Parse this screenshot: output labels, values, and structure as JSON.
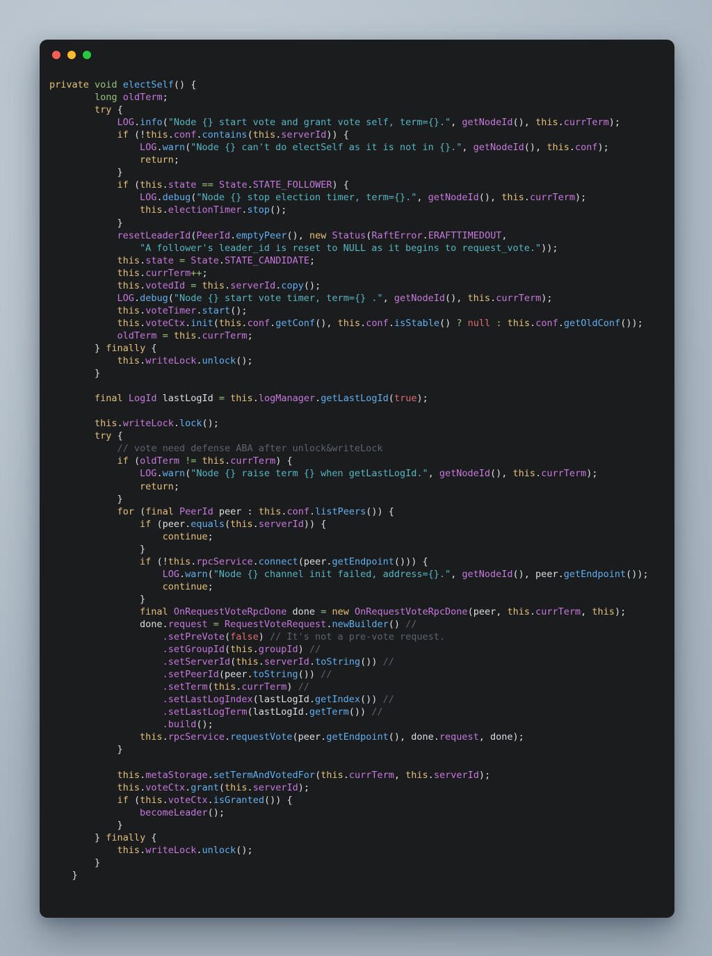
{
  "window": {
    "title": "",
    "traffic_lights": [
      {
        "name": "close",
        "color": "#ff5f57"
      },
      {
        "name": "minimize",
        "color": "#febc2e"
      },
      {
        "name": "maximize",
        "color": "#28c840"
      }
    ],
    "background_color": "#1b1c1e"
  },
  "theme": {
    "desktop_background": "#aab6c1",
    "keyword": "#e5c07b",
    "type": "#98c379",
    "function": "#61afef",
    "class": "#c678dd",
    "member": "#c678dd",
    "plain": "#dcdfe4",
    "string": "#56b6c2",
    "literal": "#e06c75",
    "operator": "#98c379",
    "comment": "#5c6370"
  },
  "code": {
    "language": "java",
    "method_name": "electSelf",
    "lines": [
      "private void electSelf() {",
      "        long oldTerm;",
      "        try {",
      "            LOG.info(\"Node {} start vote and grant vote self, term={}.\", getNodeId(), this.currTerm);",
      "            if (!this.conf.contains(this.serverId)) {",
      "                LOG.warn(\"Node {} can't do electSelf as it is not in {}.\", getNodeId(), this.conf);",
      "                return;",
      "            }",
      "            if (this.state == State.STATE_FOLLOWER) {",
      "                LOG.debug(\"Node {} stop election timer, term={}.\", getNodeId(), this.currTerm);",
      "                this.electionTimer.stop();",
      "            }",
      "            resetLeaderId(PeerId.emptyPeer(), new Status(RaftError.ERAFTTIMEDOUT,",
      "                \"A follower's leader_id is reset to NULL as it begins to request_vote.\"));",
      "            this.state = State.STATE_CANDIDATE;",
      "            this.currTerm++;",
      "            this.votedId = this.serverId.copy();",
      "            LOG.debug(\"Node {} start vote timer, term={} .\", getNodeId(), this.currTerm);",
      "            this.voteTimer.start();",
      "            this.voteCtx.init(this.conf.getConf(), this.conf.isStable() ? null : this.conf.getOldConf());",
      "            oldTerm = this.currTerm;",
      "        } finally {",
      "            this.writeLock.unlock();",
      "        }",
      "",
      "        final LogId lastLogId = this.logManager.getLastLogId(true);",
      "",
      "        this.writeLock.lock();",
      "        try {",
      "            // vote need defense ABA after unlock&writeLock",
      "            if (oldTerm != this.currTerm) {",
      "                LOG.warn(\"Node {} raise term {} when getLastLogId.\", getNodeId(), this.currTerm);",
      "                return;",
      "            }",
      "            for (final PeerId peer : this.conf.listPeers()) {",
      "                if (peer.equals(this.serverId)) {",
      "                    continue;",
      "                }",
      "                if (!this.rpcService.connect(peer.getEndpoint())) {",
      "                    LOG.warn(\"Node {} channel init failed, address={}.\", getNodeId(), peer.getEndpoint());",
      "                    continue;",
      "                }",
      "                final OnRequestVoteRpcDone done = new OnRequestVoteRpcDone(peer, this.currTerm, this);",
      "                done.request = RequestVoteRequest.newBuilder() //",
      "                    .setPreVote(false) // It's not a pre-vote request.",
      "                    .setGroupId(this.groupId) //",
      "                    .setServerId(this.serverId.toString()) //",
      "                    .setPeerId(peer.toString()) //",
      "                    .setTerm(this.currTerm) //",
      "                    .setLastLogIndex(lastLogId.getIndex()) //",
      "                    .setLastLogTerm(lastLogId.getTerm()) //",
      "                    .build();",
      "                this.rpcService.requestVote(peer.getEndpoint(), done.request, done);",
      "            }",
      "",
      "            this.metaStorage.setTermAndVotedFor(this.currTerm, this.serverId);",
      "            this.voteCtx.grant(this.serverId);",
      "            if (this.voteCtx.isGranted()) {",
      "                becomeLeader();",
      "            }",
      "        } finally {",
      "            this.writeLock.unlock();",
      "        }",
      "    }"
    ],
    "highlighted_html": "<span class=\"kw\">private</span> <span class=\"typ\">void</span> <span class=\"fn\">electSelf</span><span class=\"pln\">() {</span>\n<span class=\"pln\">        </span><span class=\"typ\">long</span> <span class=\"cls\">oldTerm</span><span class=\"pln\">;</span>\n<span class=\"pln\">        </span><span class=\"kw\">try</span> <span class=\"pln\">{</span>\n<span class=\"pln\">            </span><span class=\"log\">LOG</span><span class=\"pln\">.</span><span class=\"fn\">info</span><span class=\"pln\">(</span><span class=\"str\">\"Node {} start vote and grant vote self, term={}.\"</span><span class=\"pln\">, </span><span class=\"cls\">getNodeId</span><span class=\"pln\">(), </span><span class=\"var\">this</span><span class=\"pln\">.</span><span class=\"mem\">currTerm</span><span class=\"pln\">);</span>\n<span class=\"pln\">            </span><span class=\"kw\">if</span> <span class=\"pln\">(!</span><span class=\"var\">this</span><span class=\"pln\">.</span><span class=\"mem\">conf</span><span class=\"pln\">.</span><span class=\"fn\">contains</span><span class=\"pln\">(</span><span class=\"var\">this</span><span class=\"pln\">.</span><span class=\"mem\">serverId</span><span class=\"pln\">)) {</span>\n<span class=\"pln\">                </span><span class=\"log\">LOG</span><span class=\"pln\">.</span><span class=\"fn\">warn</span><span class=\"pln\">(</span><span class=\"str\">\"Node {} can't do electSelf as it is not in {}.\"</span><span class=\"pln\">, </span><span class=\"cls\">getNodeId</span><span class=\"pln\">(), </span><span class=\"var\">this</span><span class=\"pln\">.</span><span class=\"mem\">conf</span><span class=\"pln\">);</span>\n<span class=\"pln\">                </span><span class=\"kw\">return</span><span class=\"pln\">;</span>\n<span class=\"pln\">            }</span>\n<span class=\"pln\">            </span><span class=\"kw\">if</span> <span class=\"pln\">(</span><span class=\"var\">this</span><span class=\"pln\">.</span><span class=\"mem\">state</span> <span class=\"op\">==</span> <span class=\"cls\">State</span><span class=\"pln\">.</span><span class=\"mem\">STATE_FOLLOWER</span><span class=\"pln\">) {</span>\n<span class=\"pln\">                </span><span class=\"log\">LOG</span><span class=\"pln\">.</span><span class=\"fn\">debug</span><span class=\"pln\">(</span><span class=\"str\">\"Node {} stop election timer, term={}.\"</span><span class=\"pln\">, </span><span class=\"cls\">getNodeId</span><span class=\"pln\">(), </span><span class=\"var\">this</span><span class=\"pln\">.</span><span class=\"mem\">currTerm</span><span class=\"pln\">);</span>\n<span class=\"pln\">                </span><span class=\"var\">this</span><span class=\"pln\">.</span><span class=\"mem\">electionTimer</span><span class=\"pln\">.</span><span class=\"fn\">stop</span><span class=\"pln\">();</span>\n<span class=\"pln\">            }</span>\n<span class=\"pln\">            </span><span class=\"cls\">resetLeaderId</span><span class=\"pln\">(</span><span class=\"cls\">PeerId</span><span class=\"pln\">.</span><span class=\"fn\">emptyPeer</span><span class=\"pln\">(), </span><span class=\"kw\">new</span> <span class=\"cls\">Status</span><span class=\"pln\">(</span><span class=\"cls\">RaftError</span><span class=\"pln\">.</span><span class=\"mem\">ERAFTTIMEDOUT</span><span class=\"pln\">,</span>\n<span class=\"pln\">                </span><span class=\"str\">\"A follower's leader_id is reset to NULL as it begins to request_vote.\"</span><span class=\"pln\">));</span>\n<span class=\"pln\">            </span><span class=\"var\">this</span><span class=\"pln\">.</span><span class=\"mem\">state</span> <span class=\"op\">=</span> <span class=\"cls\">State</span><span class=\"pln\">.</span><span class=\"mem\">STATE_CANDIDATE</span><span class=\"pln\">;</span>\n<span class=\"pln\">            </span><span class=\"var\">this</span><span class=\"pln\">.</span><span class=\"mem\">currTerm</span><span class=\"op\">++</span><span class=\"pln\">;</span>\n<span class=\"pln\">            </span><span class=\"var\">this</span><span class=\"pln\">.</span><span class=\"mem\">votedId</span> <span class=\"op\">=</span> <span class=\"var\">this</span><span class=\"pln\">.</span><span class=\"mem\">serverId</span><span class=\"pln\">.</span><span class=\"fn\">copy</span><span class=\"pln\">();</span>\n<span class=\"pln\">            </span><span class=\"log\">LOG</span><span class=\"pln\">.</span><span class=\"fn\">debug</span><span class=\"pln\">(</span><span class=\"str\">\"Node {} start vote timer, term={} .\"</span><span class=\"pln\">, </span><span class=\"cls\">getNodeId</span><span class=\"pln\">(), </span><span class=\"var\">this</span><span class=\"pln\">.</span><span class=\"mem\">currTerm</span><span class=\"pln\">);</span>\n<span class=\"pln\">            </span><span class=\"var\">this</span><span class=\"pln\">.</span><span class=\"mem\">voteTimer</span><span class=\"pln\">.</span><span class=\"fn\">start</span><span class=\"pln\">();</span>\n<span class=\"pln\">            </span><span class=\"var\">this</span><span class=\"pln\">.</span><span class=\"mem\">voteCtx</span><span class=\"pln\">.</span><span class=\"fn\">init</span><span class=\"pln\">(</span><span class=\"var\">this</span><span class=\"pln\">.</span><span class=\"mem\">conf</span><span class=\"pln\">.</span><span class=\"fn\">getConf</span><span class=\"pln\">(), </span><span class=\"var\">this</span><span class=\"pln\">.</span><span class=\"mem\">conf</span><span class=\"pln\">.</span><span class=\"fn\">isStable</span><span class=\"pln\">() </span><span class=\"op\">?</span> <span class=\"lit\">null</span> <span class=\"op\">:</span> <span class=\"var\">this</span><span class=\"pln\">.</span><span class=\"mem\">conf</span><span class=\"pln\">.</span><span class=\"fn\">getOldConf</span><span class=\"pln\">());</span>\n<span class=\"pln\">            </span><span class=\"cls\">oldTerm</span> <span class=\"op\">=</span> <span class=\"var\">this</span><span class=\"pln\">.</span><span class=\"mem\">currTerm</span><span class=\"pln\">;</span>\n<span class=\"pln\">        } </span><span class=\"kw\">finally</span> <span class=\"pln\">{</span>\n<span class=\"pln\">            </span><span class=\"var\">this</span><span class=\"pln\">.</span><span class=\"mem\">writeLock</span><span class=\"pln\">.</span><span class=\"fn\">unlock</span><span class=\"pln\">();</span>\n<span class=\"pln\">        }</span>\n\n<span class=\"pln\">        </span><span class=\"kw\">final</span> <span class=\"cls\">LogId</span> <span class=\"pln\">lastLogId</span> <span class=\"op\">=</span> <span class=\"var\">this</span><span class=\"pln\">.</span><span class=\"mem\">logManager</span><span class=\"pln\">.</span><span class=\"fn\">getLastLogId</span><span class=\"pln\">(</span><span class=\"lit\">true</span><span class=\"pln\">);</span>\n\n<span class=\"pln\">        </span><span class=\"var\">this</span><span class=\"pln\">.</span><span class=\"mem\">writeLock</span><span class=\"pln\">.</span><span class=\"fn\">lock</span><span class=\"pln\">();</span>\n<span class=\"pln\">        </span><span class=\"kw\">try</span> <span class=\"pln\">{</span>\n<span class=\"pln\">            </span><span class=\"cmt\">// vote need defense ABA after unlock&amp;writeLock</span>\n<span class=\"pln\">            </span><span class=\"kw\">if</span> <span class=\"pln\">(</span><span class=\"cls\">oldTerm</span> <span class=\"op\">!=</span> <span class=\"var\">this</span><span class=\"pln\">.</span><span class=\"mem\">currTerm</span><span class=\"pln\">) {</span>\n<span class=\"pln\">                </span><span class=\"log\">LOG</span><span class=\"pln\">.</span><span class=\"fn\">warn</span><span class=\"pln\">(</span><span class=\"str\">\"Node {} raise term {} when getLastLogId.\"</span><span class=\"pln\">, </span><span class=\"cls\">getNodeId</span><span class=\"pln\">(), </span><span class=\"var\">this</span><span class=\"pln\">.</span><span class=\"mem\">currTerm</span><span class=\"pln\">);</span>\n<span class=\"pln\">                </span><span class=\"kw\">return</span><span class=\"pln\">;</span>\n<span class=\"pln\">            }</span>\n<span class=\"pln\">            </span><span class=\"kw\">for</span> <span class=\"pln\">(</span><span class=\"kw\">final</span> <span class=\"cls\">PeerId</span> <span class=\"pln\">peer : </span><span class=\"var\">this</span><span class=\"pln\">.</span><span class=\"mem\">conf</span><span class=\"pln\">.</span><span class=\"fn\">listPeers</span><span class=\"pln\">()) {</span>\n<span class=\"pln\">                </span><span class=\"kw\">if</span> <span class=\"pln\">(peer.</span><span class=\"fn\">equals</span><span class=\"pln\">(</span><span class=\"var\">this</span><span class=\"pln\">.</span><span class=\"mem\">serverId</span><span class=\"pln\">)) {</span>\n<span class=\"pln\">                    </span><span class=\"kw\">continue</span><span class=\"pln\">;</span>\n<span class=\"pln\">                }</span>\n<span class=\"pln\">                </span><span class=\"kw\">if</span> <span class=\"pln\">(!</span><span class=\"var\">this</span><span class=\"pln\">.</span><span class=\"mem\">rpcService</span><span class=\"pln\">.</span><span class=\"fn\">connect</span><span class=\"pln\">(peer.</span><span class=\"fn\">getEndpoint</span><span class=\"pln\">())) {</span>\n<span class=\"pln\">                    </span><span class=\"log\">LOG</span><span class=\"pln\">.</span><span class=\"fn\">warn</span><span class=\"pln\">(</span><span class=\"str\">\"Node {} channel init failed, address={}.\"</span><span class=\"pln\">, </span><span class=\"cls\">getNodeId</span><span class=\"pln\">(), peer.</span><span class=\"fn\">getEndpoint</span><span class=\"pln\">());</span>\n<span class=\"pln\">                    </span><span class=\"kw\">continue</span><span class=\"pln\">;</span>\n<span class=\"pln\">                }</span>\n<span class=\"pln\">                </span><span class=\"kw\">final</span> <span class=\"cls\">OnRequestVoteRpcDone</span> <span class=\"pln\">done</span> <span class=\"op\">=</span> <span class=\"kw\">new</span> <span class=\"cls\">OnRequestVoteRpcDone</span><span class=\"pln\">(peer, </span><span class=\"var\">this</span><span class=\"pln\">.</span><span class=\"mem\">currTerm</span><span class=\"pln\">, </span><span class=\"var\">this</span><span class=\"pln\">);</span>\n<span class=\"pln\">                done.</span><span class=\"mem\">request</span> <span class=\"op\">=</span> <span class=\"cls\">RequestVoteRequest</span><span class=\"pln\">.</span><span class=\"fn\">newBuilder</span><span class=\"pln\">() </span><span class=\"cmt\">//</span>\n<span class=\"pln\">                    </span><span class=\"mem\">.setPreVote</span><span class=\"pln\">(</span><span class=\"lit\">false</span><span class=\"pln\">) </span><span class=\"cmt\">// It's not a pre-vote request.</span>\n<span class=\"pln\">                    </span><span class=\"mem\">.setGroupId</span><span class=\"pln\">(</span><span class=\"var\">this</span><span class=\"pln\">.</span><span class=\"mem\">groupId</span><span class=\"pln\">) </span><span class=\"cmt\">//</span>\n<span class=\"pln\">                    </span><span class=\"mem\">.setServerId</span><span class=\"pln\">(</span><span class=\"var\">this</span><span class=\"pln\">.</span><span class=\"mem\">serverId</span><span class=\"pln\">.</span><span class=\"fn\">toString</span><span class=\"pln\">()) </span><span class=\"cmt\">//</span>\n<span class=\"pln\">                    </span><span class=\"mem\">.setPeerId</span><span class=\"pln\">(peer.</span><span class=\"fn\">toString</span><span class=\"pln\">()) </span><span class=\"cmt\">//</span>\n<span class=\"pln\">                    </span><span class=\"mem\">.setTerm</span><span class=\"pln\">(</span><span class=\"var\">this</span><span class=\"pln\">.</span><span class=\"mem\">currTerm</span><span class=\"pln\">) </span><span class=\"cmt\">//</span>\n<span class=\"pln\">                    </span><span class=\"mem\">.setLastLogIndex</span><span class=\"pln\">(lastLogId.</span><span class=\"fn\">getIndex</span><span class=\"pln\">()) </span><span class=\"cmt\">//</span>\n<span class=\"pln\">                    </span><span class=\"mem\">.setLastLogTerm</span><span class=\"pln\">(lastLogId.</span><span class=\"fn\">getTerm</span><span class=\"pln\">()) </span><span class=\"cmt\">//</span>\n<span class=\"pln\">                    </span><span class=\"mem\">.build</span><span class=\"pln\">();</span>\n<span class=\"pln\">                </span><span class=\"var\">this</span><span class=\"pln\">.</span><span class=\"mem\">rpcService</span><span class=\"pln\">.</span><span class=\"fn\">requestVote</span><span class=\"pln\">(peer.</span><span class=\"fn\">getEndpoint</span><span class=\"pln\">(), done.</span><span class=\"mem\">request</span><span class=\"pln\">, done);</span>\n<span class=\"pln\">            }</span>\n\n<span class=\"pln\">            </span><span class=\"var\">this</span><span class=\"pln\">.</span><span class=\"mem\">metaStorage</span><span class=\"pln\">.</span><span class=\"fn\">setTermAndVotedFor</span><span class=\"pln\">(</span><span class=\"var\">this</span><span class=\"pln\">.</span><span class=\"mem\">currTerm</span><span class=\"pln\">, </span><span class=\"var\">this</span><span class=\"pln\">.</span><span class=\"mem\">serverId</span><span class=\"pln\">);</span>\n<span class=\"pln\">            </span><span class=\"var\">this</span><span class=\"pln\">.</span><span class=\"mem\">voteCtx</span><span class=\"pln\">.</span><span class=\"fn\">grant</span><span class=\"pln\">(</span><span class=\"var\">this</span><span class=\"pln\">.</span><span class=\"mem\">serverId</span><span class=\"pln\">);</span>\n<span class=\"pln\">            </span><span class=\"kw\">if</span> <span class=\"pln\">(</span><span class=\"var\">this</span><span class=\"pln\">.</span><span class=\"mem\">voteCtx</span><span class=\"pln\">.</span><span class=\"fn\">isGranted</span><span class=\"pln\">()) {</span>\n<span class=\"pln\">                </span><span class=\"cls\">becomeLeader</span><span class=\"pln\">();</span>\n<span class=\"pln\">            }</span>\n<span class=\"pln\">        } </span><span class=\"kw\">finally</span> <span class=\"pln\">{</span>\n<span class=\"pln\">            </span><span class=\"var\">this</span><span class=\"pln\">.</span><span class=\"mem\">writeLock</span><span class=\"pln\">.</span><span class=\"fn\">unlock</span><span class=\"pln\">();</span>\n<span class=\"pln\">        }</span>\n<span class=\"pln\">    }</span>"
  }
}
